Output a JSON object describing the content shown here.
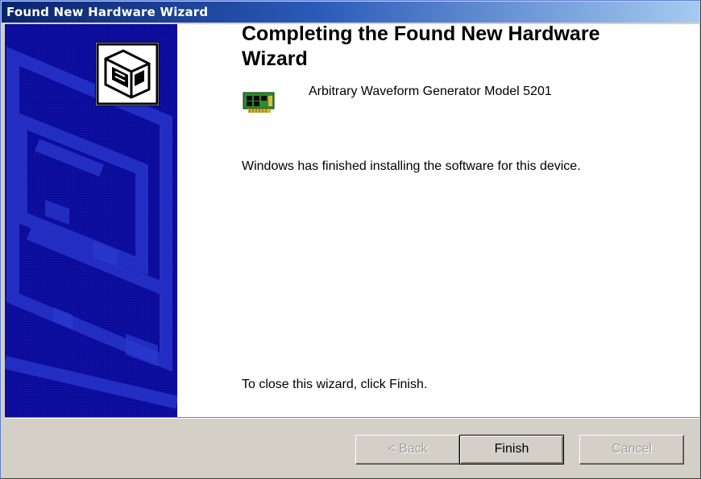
{
  "window": {
    "title": "Found New Hardware Wizard"
  },
  "main": {
    "heading": "Completing the Found New Hardware Wizard",
    "device_name": "Arbitrary Waveform Generator Model 5201",
    "device_icon": "pci-card-icon",
    "message": "Windows has finished installing the software for this device.",
    "close_hint": "To close this wizard, click Finish."
  },
  "sidebar": {
    "icon": "hardware-wizard-icon",
    "background_color": "#0d0d9e"
  },
  "buttons": {
    "back_label": "< Back",
    "finish_label": "Finish",
    "cancel_label": "Cancel"
  },
  "colors": {
    "titlebar_start": "#0a246a",
    "titlebar_end": "#a6caf0",
    "dialog_bg": "#d4d0c8"
  }
}
